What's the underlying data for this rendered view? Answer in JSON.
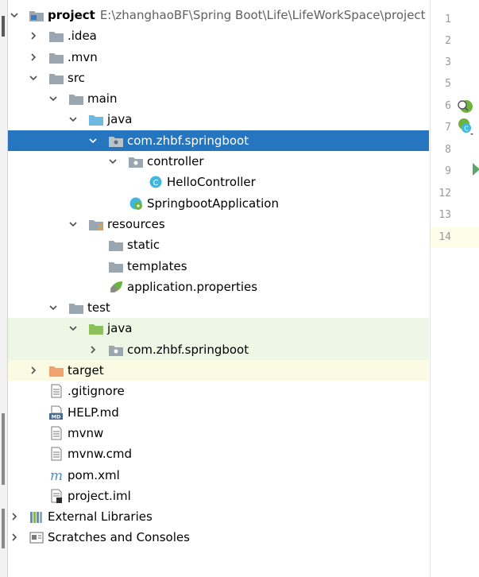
{
  "tree": {
    "root": {
      "name": "project",
      "path": "E:\\zhanghaoBF\\Spring Boot\\Life\\LifeWorkSpace\\project"
    },
    "rows": [
      {
        "label": "project",
        "expanded": true
      },
      {
        "label": ".idea",
        "expanded": false
      },
      {
        "label": ".mvn",
        "expanded": false
      },
      {
        "label": "src",
        "expanded": true
      },
      {
        "label": "main",
        "expanded": true
      },
      {
        "label": "java",
        "expanded": true
      },
      {
        "label": "com.zhbf.springboot",
        "expanded": true,
        "selected": true
      },
      {
        "label": "controller",
        "expanded": true
      },
      {
        "label": "HelloController"
      },
      {
        "label": "SpringbootApplication"
      },
      {
        "label": "resources",
        "expanded": true
      },
      {
        "label": "static"
      },
      {
        "label": "templates"
      },
      {
        "label": "application.properties"
      },
      {
        "label": "test",
        "expanded": true
      },
      {
        "label": "java",
        "expanded": true
      },
      {
        "label": "com.zhbf.springboot",
        "expanded": false
      },
      {
        "label": "target",
        "expanded": false
      },
      {
        "label": ".gitignore"
      },
      {
        "label": "HELP.md"
      },
      {
        "label": "mvnw"
      },
      {
        "label": "mvnw.cmd"
      },
      {
        "label": "pom.xml"
      },
      {
        "label": "project.iml"
      },
      {
        "label": "External Libraries",
        "expanded": false
      },
      {
        "label": "Scratches and Consoles",
        "expanded": false
      }
    ]
  },
  "gutter": {
    "line_numbers": [
      "1",
      "2",
      "3",
      "5",
      "6",
      "7",
      "8",
      "9",
      "12",
      "13",
      "14"
    ],
    "current_line": "14"
  },
  "icons": {
    "folder": "folder-icon",
    "source_folder": "source-folder-icon",
    "test_folder": "test-folder-icon",
    "resources_folder": "resources-folder-icon",
    "excluded_folder": "excluded-folder-icon",
    "package": "package-icon",
    "java_class": "java-class-icon",
    "spring_boot_app": "spring-boot-app-icon",
    "properties": "spring-properties-icon",
    "text_file": "text-file-icon",
    "markdown": "markdown-icon",
    "maven": "maven-icon",
    "module": "module-file-icon",
    "libraries": "libraries-icon",
    "scratches": "scratches-icon"
  },
  "colors": {
    "selection": "#2675bf",
    "folder": "#9aa7b0",
    "source_folder": "#6fb8e4",
    "test_folder": "#8cc05a",
    "excluded_folder": "#f0a36e",
    "class": "#40b6e0",
    "spring": "#6db33f",
    "test_bg": "#eef7e6",
    "excluded_bg": "#fbfbe4"
  }
}
